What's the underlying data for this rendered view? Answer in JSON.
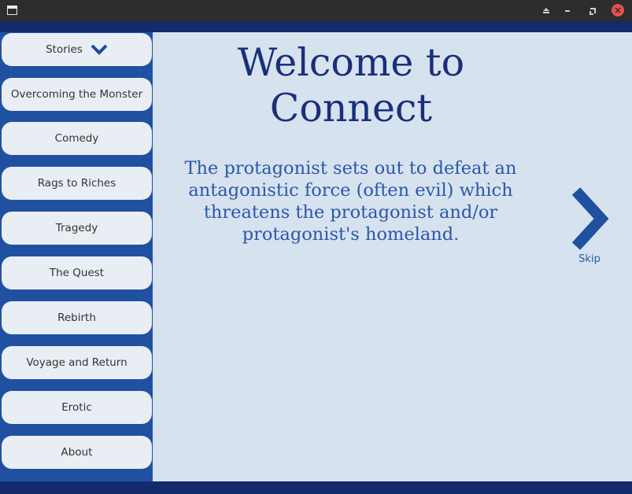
{
  "window": {
    "close_glyph": "×"
  },
  "sidebar": {
    "stories_label": "Stories",
    "items": [
      {
        "label": "Overcoming the Monster"
      },
      {
        "label": "Comedy"
      },
      {
        "label": "Rags to Riches"
      },
      {
        "label": "Tragedy"
      },
      {
        "label": "The Quest"
      },
      {
        "label": "Rebirth"
      },
      {
        "label": "Voyage and Return"
      },
      {
        "label": "Erotic"
      },
      {
        "label": "About"
      }
    ]
  },
  "main": {
    "title": "Welcome to Connect",
    "description": "The protagonist sets out to defeat an antagonistic force (often evil) which threatens the protagonist and/or protagonist's homeland.",
    "skip_label": "Skip"
  },
  "icons": {
    "stories_toggle": "chevron-down-icon",
    "skip": "chevron-right-icon"
  },
  "colors": {
    "frame": "#132a6b",
    "sidebar": "#2051a0",
    "main_bg": "#d6e2ee",
    "button_bg": "#e9eef4",
    "title_text": "#1a2f7a",
    "body_text": "#2b57aa"
  }
}
